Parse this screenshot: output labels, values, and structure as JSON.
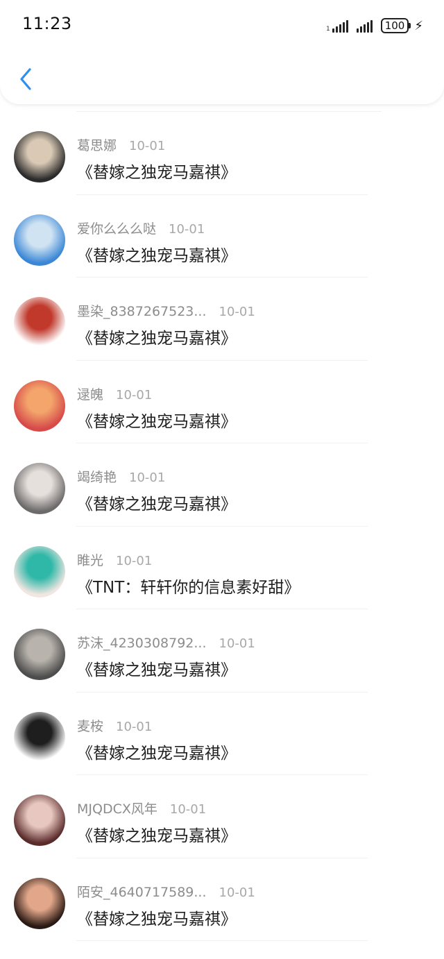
{
  "status_bar": {
    "time": "11:23",
    "battery": "100",
    "signal_sub": "1"
  },
  "colors": {
    "accent": "#2f8ff0"
  },
  "header": {
    "back_icon": "chevron-left-icon"
  },
  "items": [
    {
      "name": "葛思娜",
      "date": "10-01",
      "title": "《替嫁之独宠马嘉祺》",
      "avatar_colors": [
        "#2b2b2b",
        "#d9c9b5"
      ]
    },
    {
      "name": "爱你么么么哒",
      "date": "10-01",
      "title": "《替嫁之独宠马嘉祺》",
      "avatar_colors": [
        "#3b87d6",
        "#cfe3f2"
      ]
    },
    {
      "name": "墨染_8387267523...",
      "date": "10-01",
      "title": "《替嫁之独宠马嘉祺》",
      "avatar_colors": [
        "#ffffff",
        "#c0392b"
      ]
    },
    {
      "name": "逯魄",
      "date": "10-01",
      "title": "《替嫁之独宠马嘉祺》",
      "avatar_colors": [
        "#d64a4a",
        "#f3a56b"
      ]
    },
    {
      "name": "竭绮艳",
      "date": "10-01",
      "title": "《替嫁之独宠马嘉祺》",
      "avatar_colors": [
        "#6d6a6a",
        "#e6e0dc"
      ]
    },
    {
      "name": "睢光",
      "date": "10-01",
      "title": "《TNT：轩轩你的信息素好甜》",
      "avatar_colors": [
        "#f2e6e2",
        "#2fb8a8"
      ]
    },
    {
      "name": "苏沫_4230308792...",
      "date": "10-01",
      "title": "《替嫁之独宠马嘉祺》",
      "avatar_colors": [
        "#4d4d4d",
        "#b8b3ac"
      ]
    },
    {
      "name": "麦桉",
      "date": "10-01",
      "title": "《替嫁之独宠马嘉祺》",
      "avatar_colors": [
        "#ffffff",
        "#1e1e1e"
      ]
    },
    {
      "name": "MJQDCX风年",
      "date": "10-01",
      "title": "《替嫁之独宠马嘉祺》",
      "avatar_colors": [
        "#5a2b2b",
        "#e8c7c0"
      ]
    },
    {
      "name": "陌安_4640717589...",
      "date": "10-01",
      "title": "《替嫁之独宠马嘉祺》",
      "avatar_colors": [
        "#2b1a14",
        "#e2a78a"
      ]
    }
  ]
}
